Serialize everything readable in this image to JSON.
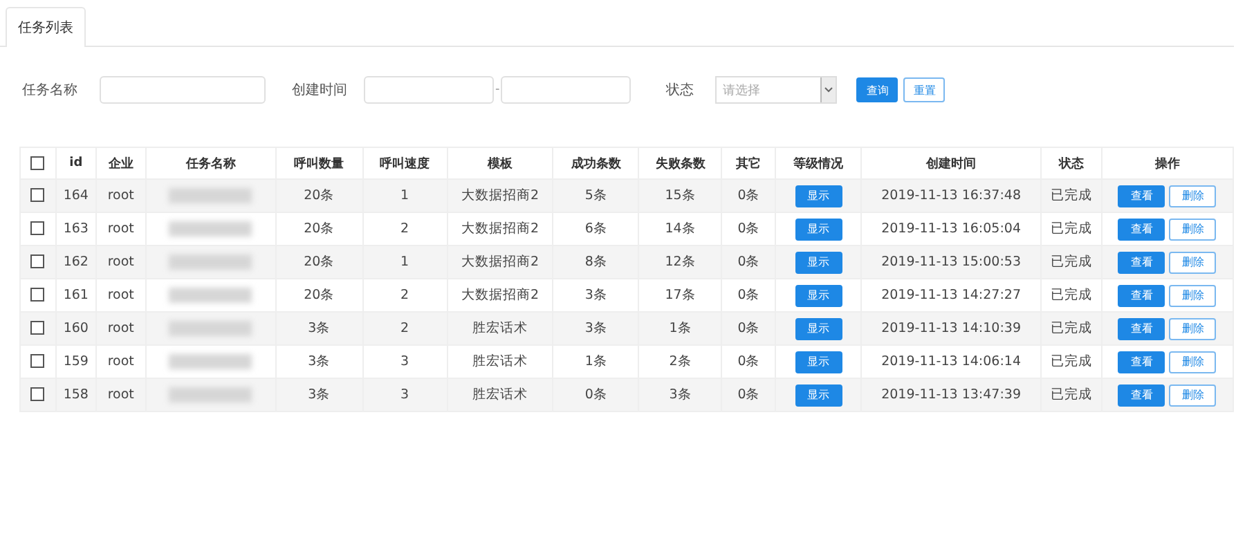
{
  "tabs": [
    {
      "label": "任务列表",
      "selected": true
    }
  ],
  "filters": {
    "name_label": "任务名称",
    "time_label": "创建时间",
    "time_separator": "-",
    "status_label": "状态",
    "status_placeholder": "请选择",
    "search_button": "查询",
    "reset_button": "重置"
  },
  "table": {
    "select_all_checked": false,
    "columns": [
      "id",
      "企业",
      "任务名称",
      "呼叫数量",
      "呼叫速度",
      "模板",
      "成功条数",
      "失败条数",
      "其它",
      "等级情况",
      "创建时间",
      "状态",
      "操作"
    ],
    "rows": [
      {
        "checked": false,
        "id": "164",
        "company": "root",
        "name_blurred": true,
        "calls": "20条",
        "speed": "1",
        "template": "大数据招商2",
        "success": "5条",
        "fail": "15条",
        "other": "0条",
        "level_button": "显示",
        "created": "2019-11-13 16:37:48",
        "status": "已完成",
        "view": "查看",
        "delete": "删除"
      },
      {
        "checked": false,
        "id": "163",
        "company": "root",
        "name_blurred": true,
        "calls": "20条",
        "speed": "2",
        "template": "大数据招商2",
        "success": "6条",
        "fail": "14条",
        "other": "0条",
        "level_button": "显示",
        "created": "2019-11-13 16:05:04",
        "status": "已完成",
        "view": "查看",
        "delete": "删除"
      },
      {
        "checked": false,
        "id": "162",
        "company": "root",
        "name_blurred": true,
        "calls": "20条",
        "speed": "1",
        "template": "大数据招商2",
        "success": "8条",
        "fail": "12条",
        "other": "0条",
        "level_button": "显示",
        "created": "2019-11-13 15:00:53",
        "status": "已完成",
        "view": "查看",
        "delete": "删除"
      },
      {
        "checked": false,
        "id": "161",
        "company": "root",
        "name_blurred": true,
        "calls": "20条",
        "speed": "2",
        "template": "大数据招商2",
        "success": "3条",
        "fail": "17条",
        "other": "0条",
        "level_button": "显示",
        "created": "2019-11-13 14:27:27",
        "status": "已完成",
        "view": "查看",
        "delete": "删除"
      },
      {
        "checked": false,
        "id": "160",
        "company": "root",
        "name_blurred": true,
        "calls": "3条",
        "speed": "2",
        "template": "胜宏话术",
        "success": "3条",
        "fail": "1条",
        "other": "0条",
        "level_button": "显示",
        "created": "2019-11-13 14:10:39",
        "status": "已完成",
        "view": "查看",
        "delete": "删除"
      },
      {
        "checked": false,
        "id": "159",
        "company": "root",
        "name_blurred": true,
        "calls": "3条",
        "speed": "3",
        "template": "胜宏话术",
        "success": "1条",
        "fail": "2条",
        "other": "0条",
        "level_button": "显示",
        "created": "2019-11-13 14:06:14",
        "status": "已完成",
        "view": "查看",
        "delete": "删除"
      },
      {
        "checked": false,
        "id": "158",
        "company": "root",
        "name_blurred": true,
        "calls": "3条",
        "speed": "3",
        "template": "胜宏话术",
        "success": "0条",
        "fail": "3条",
        "other": "0条",
        "level_button": "显示",
        "created": "2019-11-13 13:47:39",
        "status": "已完成",
        "view": "查看",
        "delete": "删除"
      }
    ]
  }
}
